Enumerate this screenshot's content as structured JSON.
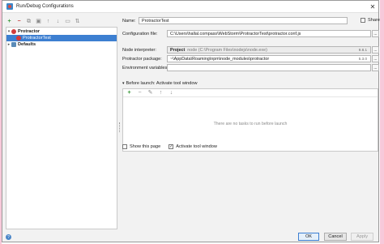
{
  "window": {
    "title": "Run/Debug Configurations",
    "close_glyph": "✕"
  },
  "toolbar": [
    "add-icon",
    "remove-icon",
    "copy-icon",
    "save-icon",
    "move-up-icon",
    "move-down-icon",
    "folder-icon",
    "sort-icon"
  ],
  "tree": {
    "protractor": "Protractor",
    "protractor_test": "ProtractorTest",
    "defaults": "Defaults"
  },
  "form": {
    "name_label": "Name:",
    "name_value": "ProtractorTest",
    "share_label": "Share",
    "config_label": "Configuration file:",
    "config_value": "C:\\Users\\hallal.compass\\WebStorm\\ProtractorTest\\protractor.conf.js",
    "node_label": "Node interpreter:",
    "node_value_bold": "Project",
    "node_value_rest": "node (C:\\Program Files\\nodejs\\node.exe)",
    "node_version": "9.8.1",
    "pkg_label": "Protractor package:",
    "pkg_value": "~\\AppData\\Roaming\\npm\\node_modules\\protractor",
    "pkg_version": "5.3.0",
    "env_label": "Environment variables:",
    "dots": "..."
  },
  "before_launch": {
    "header": "Before launch: Activate tool window",
    "empty": "There are no tasks to run before launch"
  },
  "options": {
    "show_page": "Show this page",
    "activate_tool": "Activate tool window",
    "show_page_checked": false,
    "activate_tool_checked": true
  },
  "buttons": {
    "ok": "OK",
    "cancel": "Cancel",
    "apply": "Apply"
  }
}
